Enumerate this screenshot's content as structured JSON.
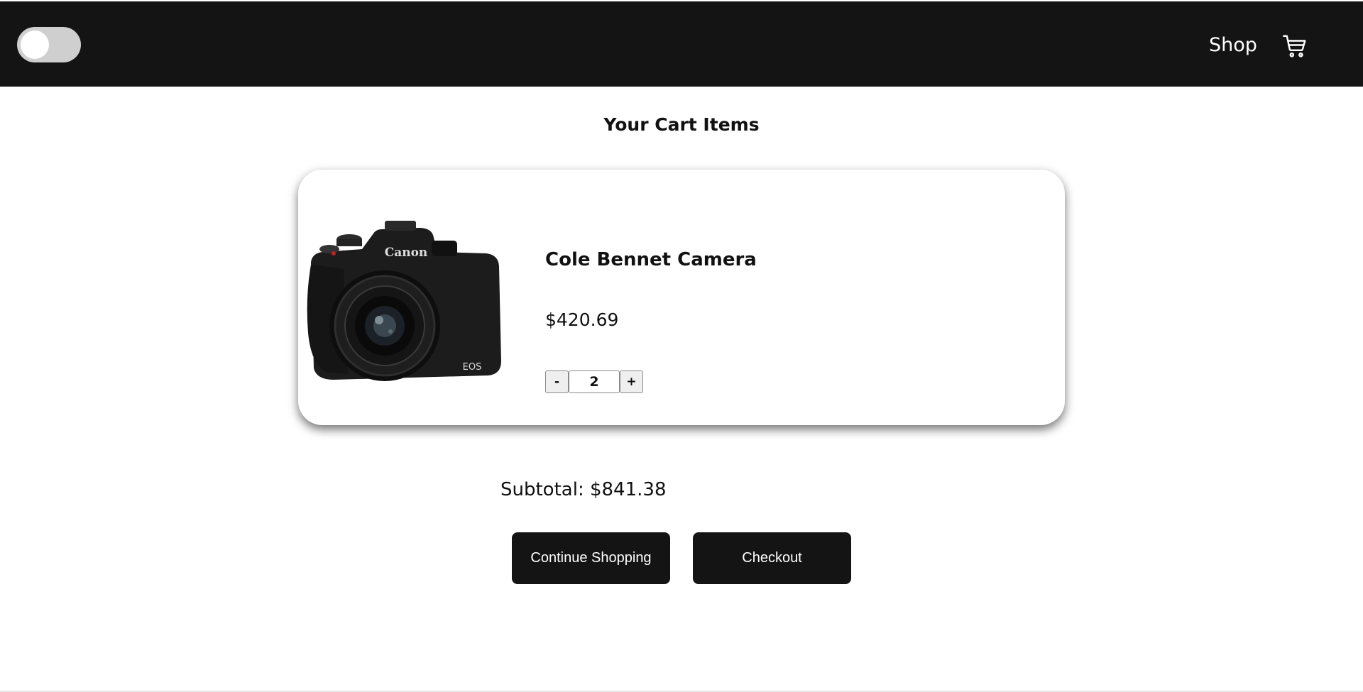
{
  "header": {
    "theme_toggle": "off",
    "nav_shop_label": "Shop",
    "cart_icon": "shopping-cart-icon",
    "background_color": "#141414"
  },
  "page": {
    "title": "Your Cart Items"
  },
  "cart": {
    "items": [
      {
        "name": "Cole Bennet Camera",
        "price": "$420.69",
        "quantity": "2",
        "image": "camera-image",
        "image_branding": [
          "Canon",
          "EOS"
        ]
      }
    ],
    "decrement_label": "-",
    "increment_label": "+",
    "subtotal": "Subtotal: $841.38"
  },
  "actions": {
    "continue_label": "Continue Shopping",
    "checkout_label": "Checkout"
  }
}
